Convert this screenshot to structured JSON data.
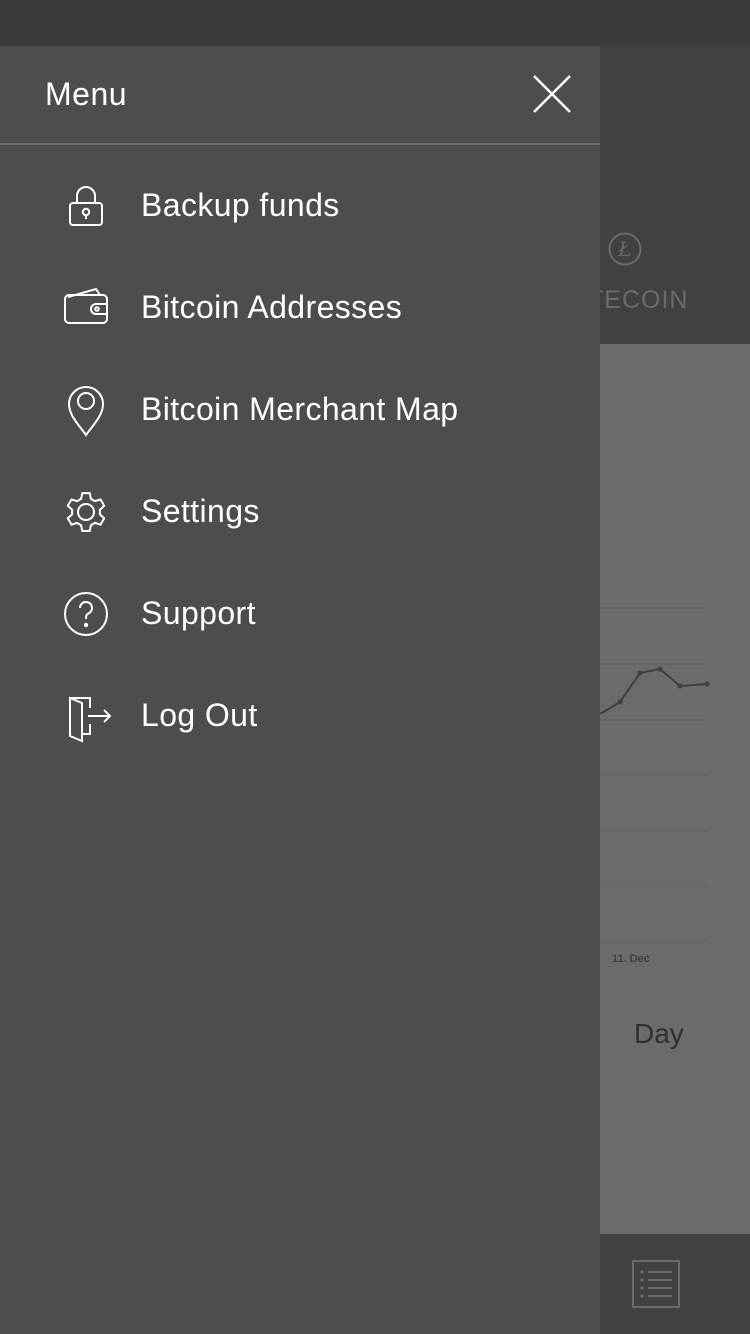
{
  "drawer": {
    "title": "Menu",
    "items": [
      {
        "label": "Backup funds",
        "icon": "lock-icon"
      },
      {
        "label": "Bitcoin Addresses",
        "icon": "wallet-icon"
      },
      {
        "label": "Bitcoin Merchant Map",
        "icon": "map-pin-icon"
      },
      {
        "label": "Settings",
        "icon": "gear-icon"
      },
      {
        "label": "Support",
        "icon": "help-circle-icon"
      },
      {
        "label": "Log Out",
        "icon": "logout-icon"
      }
    ]
  },
  "background": {
    "coin_tab_label": "TECOIN",
    "coin_symbol": "Ł",
    "chart_date_label": "11. Dec",
    "range_label": "Day"
  },
  "colors": {
    "drawer_bg": "#4c4d4f",
    "overlay_dim": "#3e3f41",
    "text": "#ffffff"
  }
}
